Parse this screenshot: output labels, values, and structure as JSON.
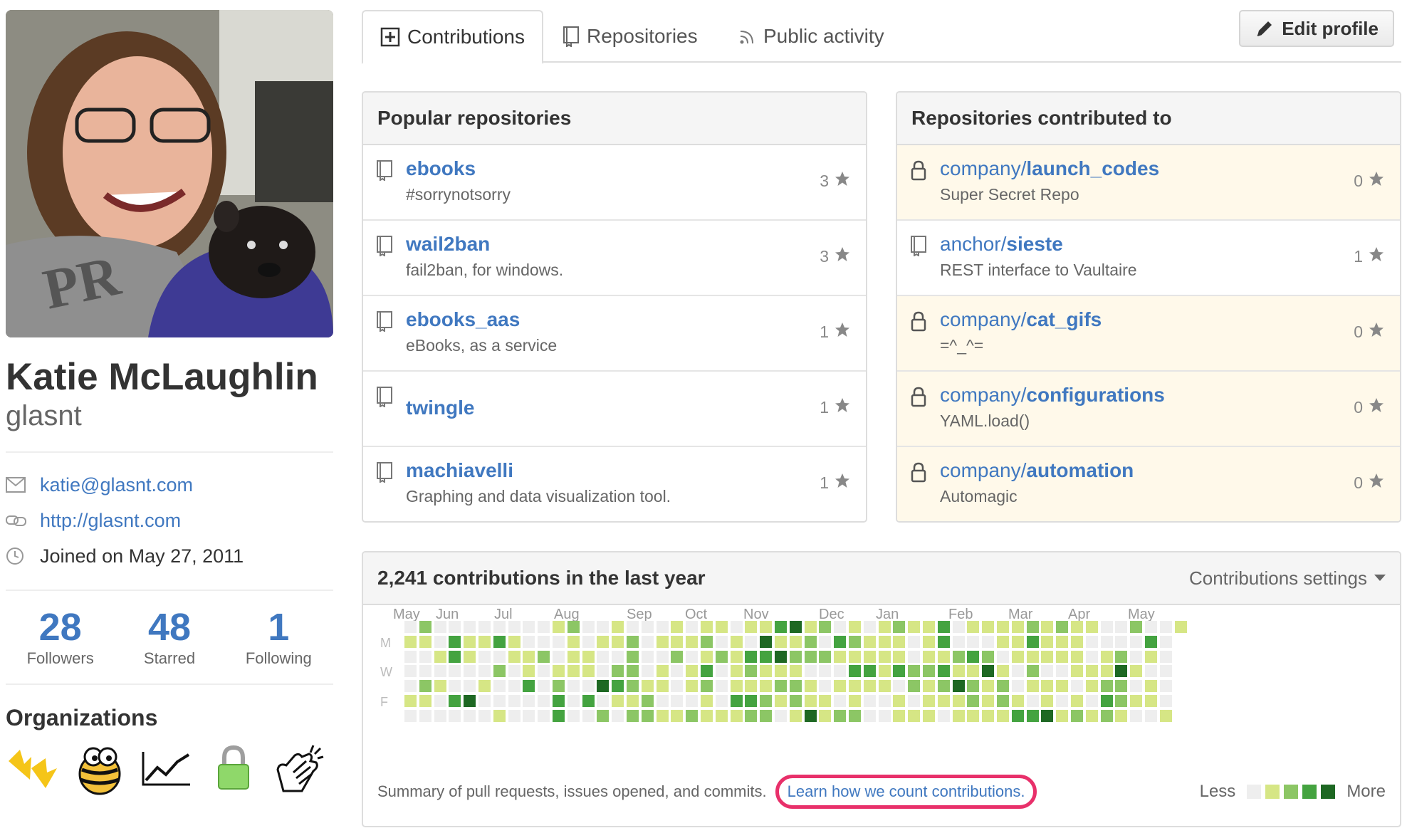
{
  "colors": {
    "link": "#4078c0",
    "private_row": "#fff9ea",
    "highlight_ring": "#e8306a",
    "levels": [
      "#eeeeee",
      "#d6e685",
      "#8cc665",
      "#44a340",
      "#1e6823"
    ]
  },
  "profile": {
    "full_name": "Katie McLaughlin",
    "username": "glasnt",
    "email": "katie@glasnt.com",
    "website": "http://glasnt.com",
    "joined": "Joined on May 27, 2011",
    "stats": [
      {
        "value": "28",
        "label": "Followers"
      },
      {
        "value": "48",
        "label": "Starred"
      },
      {
        "value": "1",
        "label": "Following"
      }
    ],
    "organizations_title": "Organizations",
    "organizations": [
      "duck-feet-icon",
      "bee-icon",
      "chart-icon",
      "lock-icon",
      "clapping-hands-icon"
    ]
  },
  "tabs": {
    "contributions": "Contributions",
    "repositories": "Repositories",
    "public_activity": "Public activity",
    "edit_profile": "Edit profile"
  },
  "popular": {
    "title": "Popular repositories",
    "repos": [
      {
        "name": "ebooks",
        "desc": "#sorrynotsorry",
        "stars": "3"
      },
      {
        "name": "wail2ban",
        "desc": "fail2ban, for windows.",
        "stars": "3"
      },
      {
        "name": "ebooks_aas",
        "desc": "eBooks, as a service",
        "stars": "1"
      },
      {
        "name": "twingle",
        "desc": "",
        "stars": "1"
      },
      {
        "name": "machiavelli",
        "desc": "Graphing and data visualization tool.",
        "stars": "1"
      }
    ]
  },
  "contributed": {
    "title": "Repositories contributed to",
    "repos": [
      {
        "owner": "company/",
        "name": "launch_codes",
        "desc": "Super Secret Repo",
        "stars": "0",
        "private": true
      },
      {
        "owner": "anchor/",
        "name": "sieste",
        "desc": "REST interface to Vaultaire",
        "stars": "1",
        "private": false
      },
      {
        "owner": "company/",
        "name": "cat_gifs",
        "desc": "=^_^=",
        "stars": "0",
        "private": true
      },
      {
        "owner": "company/",
        "name": "configurations",
        "desc": "YAML.load()",
        "stars": "0",
        "private": true
      },
      {
        "owner": "company/",
        "name": "automation",
        "desc": "Automagic",
        "stars": "0",
        "private": true
      }
    ]
  },
  "contributions": {
    "title": "2,241 contributions in the last year",
    "settings": "Contributions settings",
    "months": [
      "May",
      "Jun",
      "Jul",
      "Aug",
      "Sep",
      "Oct",
      "Nov",
      "Dec",
      "Jan",
      "Feb",
      "Mar",
      "Apr",
      "May"
    ],
    "day_labels": [
      "M",
      "W",
      "F"
    ],
    "summary": "Summary of pull requests, issues opened, and commits.",
    "learn_link": "Learn how we count contributions.",
    "legend_less": "Less",
    "legend_more": "More"
  }
}
